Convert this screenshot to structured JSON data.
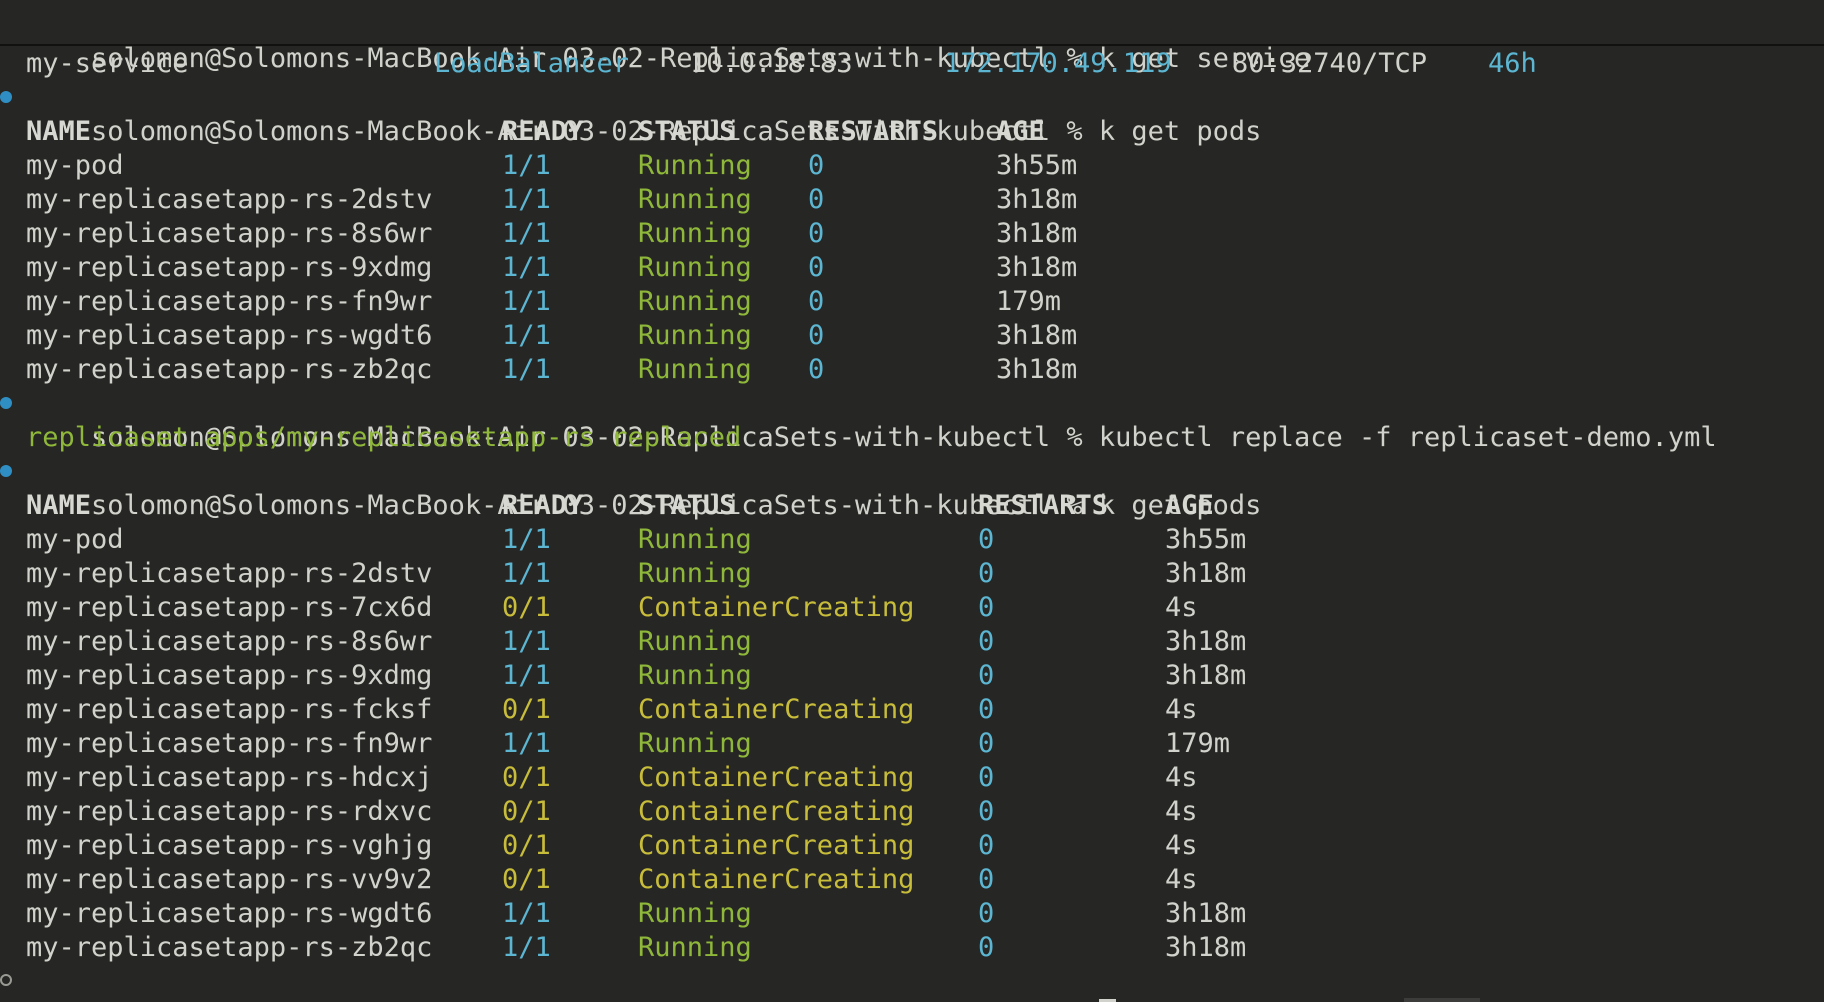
{
  "colors": {
    "background": "#262624",
    "text": "#d2d2cc",
    "cyan": "#5cb6d2",
    "green": "#8fb83a",
    "yellow": "#c8bd3a",
    "marker": "#2f8fc4"
  },
  "prompt": "solomon@Solomons-MacBook-Air 03-02-ReplicaSets-with-kubectl %",
  "commands": {
    "get_service": "k get service",
    "get_pods_1": "k get pods",
    "replace": "kubectl replace -f replicaset-demo.yml",
    "get_pods_2": "k get pods"
  },
  "service_row": {
    "name": "my-service",
    "type": "LoadBalancer",
    "cluster_ip": "10.0.18.83",
    "external_ip": "172.170.49.119",
    "ports": "80:32740/TCP",
    "age": "46h"
  },
  "table_headers": {
    "name": "NAME",
    "ready": "READY",
    "status": "STATUS",
    "restarts": "RESTARTS",
    "age": "AGE"
  },
  "pods_before": [
    {
      "name": "my-pod",
      "ready": "1/1",
      "status": "Running",
      "restarts": "0",
      "age": "3h55m"
    },
    {
      "name": "my-replicasetapp-rs-2dstv",
      "ready": "1/1",
      "status": "Running",
      "restarts": "0",
      "age": "3h18m"
    },
    {
      "name": "my-replicasetapp-rs-8s6wr",
      "ready": "1/1",
      "status": "Running",
      "restarts": "0",
      "age": "3h18m"
    },
    {
      "name": "my-replicasetapp-rs-9xdmg",
      "ready": "1/1",
      "status": "Running",
      "restarts": "0",
      "age": "3h18m"
    },
    {
      "name": "my-replicasetapp-rs-fn9wr",
      "ready": "1/1",
      "status": "Running",
      "restarts": "0",
      "age": "179m"
    },
    {
      "name": "my-replicasetapp-rs-wgdt6",
      "ready": "1/1",
      "status": "Running",
      "restarts": "0",
      "age": "3h18m"
    },
    {
      "name": "my-replicasetapp-rs-zb2qc",
      "ready": "1/1",
      "status": "Running",
      "restarts": "0",
      "age": "3h18m"
    }
  ],
  "replace_output": "replicaset.apps/my-replicasetapp-rs replaced",
  "pods_after": [
    {
      "name": "my-pod",
      "ready": "1/1",
      "status": "Running",
      "restarts": "0",
      "age": "3h55m"
    },
    {
      "name": "my-replicasetapp-rs-2dstv",
      "ready": "1/1",
      "status": "Running",
      "restarts": "0",
      "age": "3h18m"
    },
    {
      "name": "my-replicasetapp-rs-7cx6d",
      "ready": "0/1",
      "status": "ContainerCreating",
      "restarts": "0",
      "age": "4s"
    },
    {
      "name": "my-replicasetapp-rs-8s6wr",
      "ready": "1/1",
      "status": "Running",
      "restarts": "0",
      "age": "3h18m"
    },
    {
      "name": "my-replicasetapp-rs-9xdmg",
      "ready": "1/1",
      "status": "Running",
      "restarts": "0",
      "age": "3h18m"
    },
    {
      "name": "my-replicasetapp-rs-fcksf",
      "ready": "0/1",
      "status": "ContainerCreating",
      "restarts": "0",
      "age": "4s"
    },
    {
      "name": "my-replicasetapp-rs-fn9wr",
      "ready": "1/1",
      "status": "Running",
      "restarts": "0",
      "age": "179m"
    },
    {
      "name": "my-replicasetapp-rs-hdcxj",
      "ready": "0/1",
      "status": "ContainerCreating",
      "restarts": "0",
      "age": "4s"
    },
    {
      "name": "my-replicasetapp-rs-rdxvc",
      "ready": "0/1",
      "status": "ContainerCreating",
      "restarts": "0",
      "age": "4s"
    },
    {
      "name": "my-replicasetapp-rs-vghjg",
      "ready": "0/1",
      "status": "ContainerCreating",
      "restarts": "0",
      "age": "4s"
    },
    {
      "name": "my-replicasetapp-rs-vv9v2",
      "ready": "0/1",
      "status": "ContainerCreating",
      "restarts": "0",
      "age": "4s"
    },
    {
      "name": "my-replicasetapp-rs-wgdt6",
      "ready": "1/1",
      "status": "Running",
      "restarts": "0",
      "age": "3h18m"
    },
    {
      "name": "my-replicasetapp-rs-zb2qc",
      "ready": "1/1",
      "status": "Running",
      "restarts": "0",
      "age": "3h18m"
    }
  ]
}
